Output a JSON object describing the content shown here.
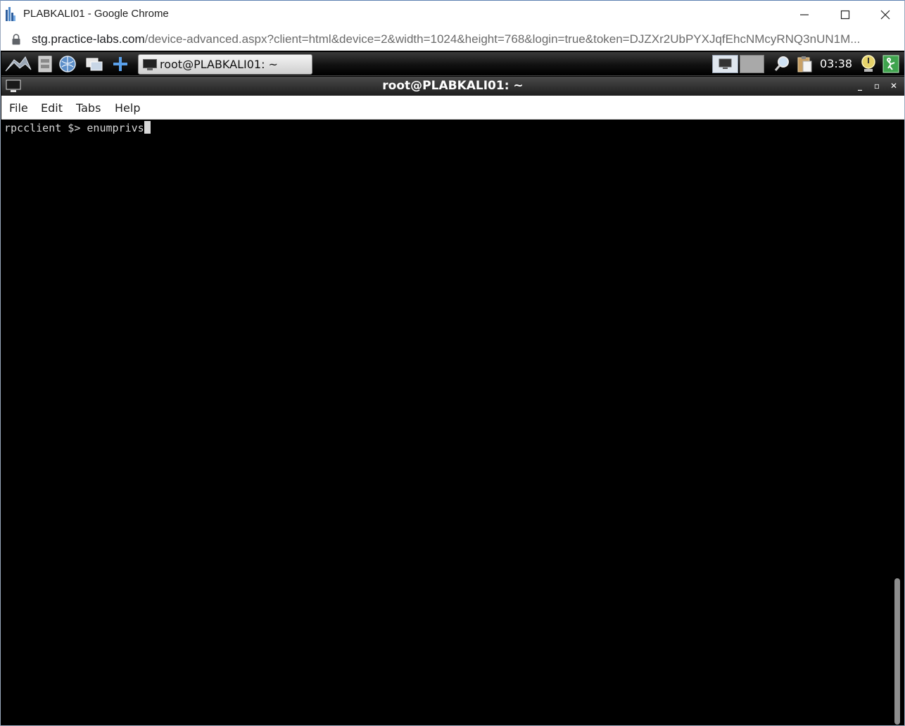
{
  "window": {
    "title": "PLABKALI01 - Google Chrome"
  },
  "address_bar": {
    "url_host": "stg.practice-labs.com",
    "url_rest": "/device-advanced.aspx?client=html&device=2&width=1024&height=768&login=true&token=DJZXr2UbPYXJqfEhcNMcyRNQ3nUN1M..."
  },
  "kali_panel": {
    "task_button_label": "root@PLABKALI01: ~",
    "clock": "03:38"
  },
  "terminal": {
    "title": "root@PLABKALI01: ~",
    "controls": {
      "minimize": "_",
      "maximize": "▫",
      "close": "✕"
    },
    "menu": {
      "file": "File",
      "edit": "Edit",
      "tabs": "Tabs",
      "help": "Help"
    },
    "prompt": "rpcclient $> ",
    "command": "enumprivs"
  },
  "colors": {
    "terminal_bg": "#000000",
    "terminal_fg": "#d7d7d7",
    "panel_bg": "#111111"
  },
  "icons": {
    "app_logo": "practice-labs-logo",
    "lock": "lock-icon",
    "kali_menu": "kali-dragon-icon",
    "file_manager": "file-cabinet-icon",
    "browser": "globe-icon",
    "show_desktop": "windows-icon",
    "add": "plus-icon",
    "terminal": "terminal-icon",
    "search": "magnifier-icon",
    "clipboard": "clipboard-icon",
    "notification": "notification-icon",
    "logout": "exit-icon"
  }
}
